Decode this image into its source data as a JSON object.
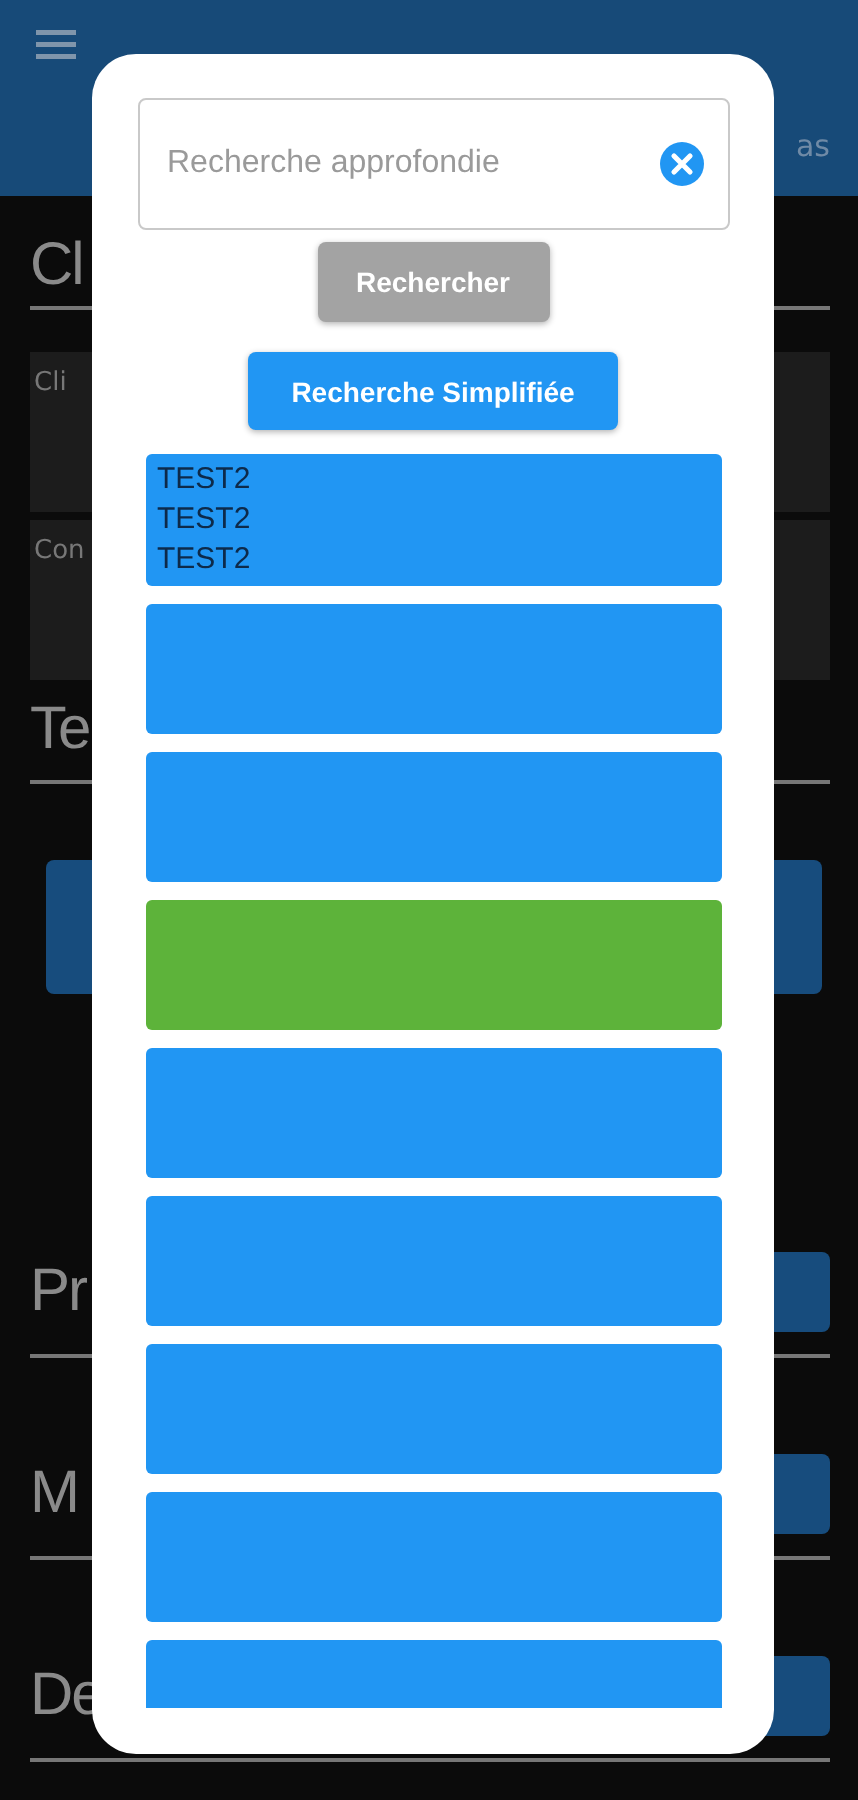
{
  "app_bar": {
    "action": "as"
  },
  "background_sections": [
    {
      "kind": "cards",
      "title": "Cl",
      "cards": [
        {
          "label": "Cli"
        },
        {
          "label": "Con"
        }
      ]
    },
    {
      "kind": "wide_button",
      "title": "Te"
    },
    {
      "kind": "row",
      "title": "Pr"
    },
    {
      "kind": "row",
      "title": "M"
    },
    {
      "kind": "row",
      "title": "De"
    }
  ],
  "dialog": {
    "search": {
      "placeholder": "Recherche approfondie"
    },
    "search_button": {
      "label": "Rechercher",
      "disabled": true
    },
    "mode_button": {
      "label": "Recherche Simplifiée"
    },
    "results": [
      {
        "lines": [
          "TEST2",
          "TEST2",
          "TEST2"
        ],
        "color": "#2196f3"
      },
      {
        "color": "#2196f3"
      },
      {
        "color": "#2196f3"
      },
      {
        "color": "#5db33a"
      },
      {
        "color": "#2196f3"
      },
      {
        "color": "#2196f3"
      },
      {
        "color": "#2196f3"
      },
      {
        "color": "#2196f3"
      },
      {
        "color": "#2196f3"
      }
    ]
  }
}
